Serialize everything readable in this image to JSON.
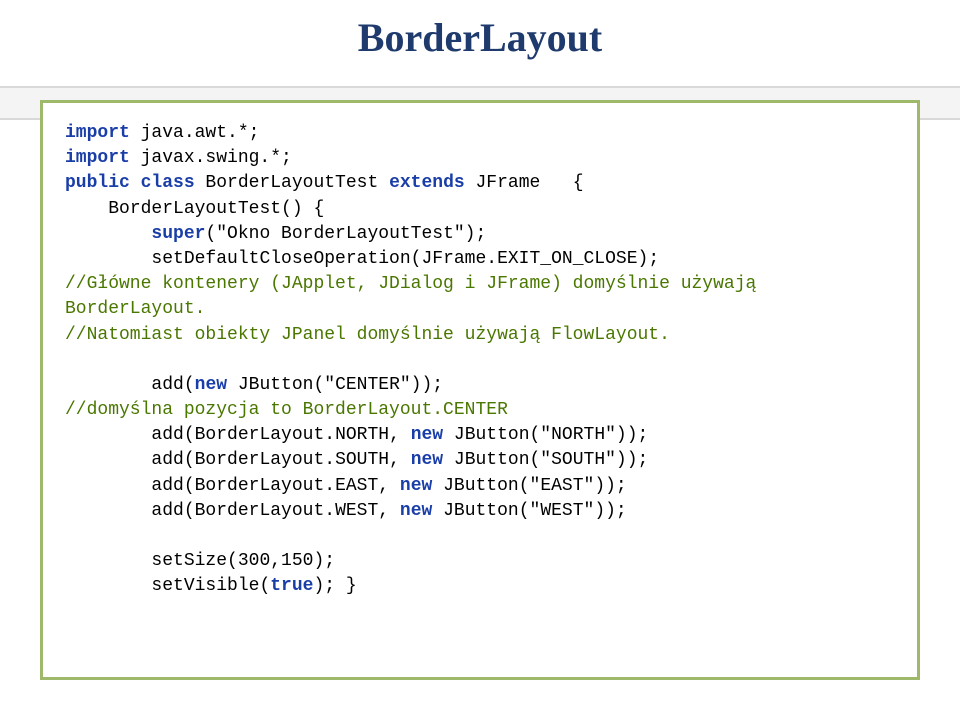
{
  "title": "BorderLayout",
  "code": {
    "l1_import": "import",
    "l1_pkg": " java.awt.*;",
    "l2_import": "import",
    "l2_pkg": " javax.swing.*;",
    "l3_public": "public",
    "l3_class": " class",
    "l3_name": " BorderLayoutTest ",
    "l3_extends": "extends",
    "l3_super": " JFrame   {",
    "l4": "    BorderLayoutTest() {",
    "l5_super": "        super",
    "l5_arg": "(\"Okno BorderLayoutTest\");",
    "l6_a": "        setDefaultCloseOperation(JFrame.",
    "l6_b": "EXIT_ON_CLOSE",
    "l6_c": ");",
    "l7": "//Główne kontenery (JApplet, JDialog i JFrame) domyślnie używają BorderLayout.",
    "l8": "//Natomiast obiekty JPanel domyślnie używają FlowLayout.",
    "blank1": "",
    "l9_a": "        add(",
    "l9_new": "new",
    "l9_b": " JButton(\"CENTER\"));",
    "l10": "//domyślna pozycja to BorderLayout.CENTER",
    "l11_a": "        add(BorderLayout.",
    "l11_b": "NORTH",
    "l11_c": ", ",
    "l11_new": "new",
    "l11_d": " JButton(\"NORTH\"));",
    "l12_a": "        add(BorderLayout.",
    "l12_b": "SOUTH",
    "l12_c": ", ",
    "l12_new": "new",
    "l12_d": " JButton(\"SOUTH\"));",
    "l13_a": "        add(BorderLayout.",
    "l13_b": "EAST",
    "l13_c": ", ",
    "l13_new": "new",
    "l13_d": " JButton(\"EAST\"));",
    "l14_a": "        add(BorderLayout.",
    "l14_b": "WEST",
    "l14_c": ", ",
    "l14_new": "new",
    "l14_d": " JButton(\"WEST\"));",
    "blank2": "",
    "l15": "        setSize(300,150);",
    "l16_a": "        setVisible(",
    "l16_true": "true",
    "l16_b": "); }"
  }
}
